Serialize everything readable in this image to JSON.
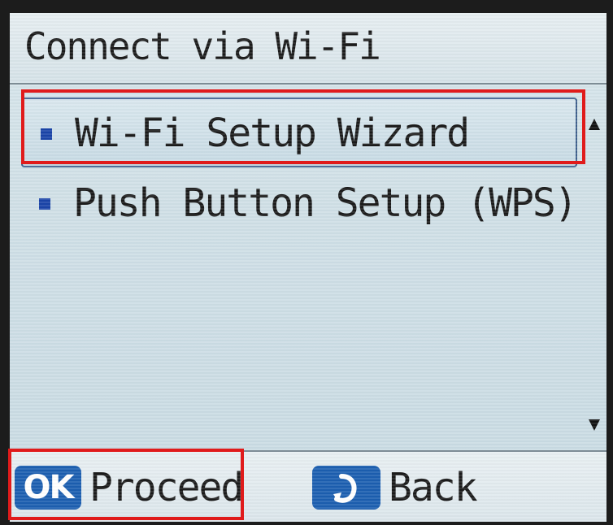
{
  "screen": {
    "title": "Connect via Wi-Fi"
  },
  "menu": {
    "items": [
      {
        "label": "Wi-Fi Setup Wizard",
        "selected": true
      },
      {
        "label": "Push Button Setup (WPS)",
        "selected": false
      }
    ]
  },
  "softkeys": {
    "ok_badge": "OK",
    "proceed_label": "Proceed",
    "back_label": "Back"
  },
  "icons": {
    "bullet": "square-bullet-icon",
    "scroll_up": "scroll-up-arrow-icon",
    "scroll_down": "scroll-down-arrow-icon",
    "back": "back-arrow-icon"
  },
  "colors": {
    "accent_blue": "#1c5fb0",
    "highlight_red": "#e01b1b",
    "selection_border": "#3d5f8c"
  }
}
